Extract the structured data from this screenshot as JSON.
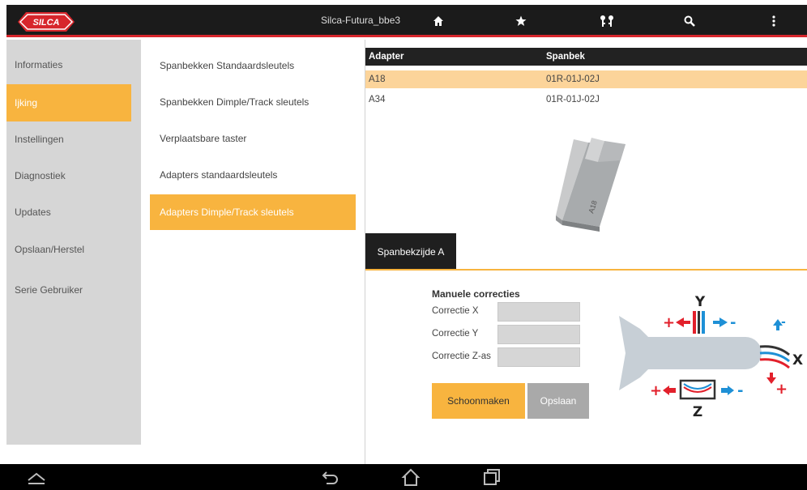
{
  "header": {
    "title": "Silca-Futura_bbe3",
    "logo_text": "SILCA",
    "icons": [
      "home-icon",
      "star-icon",
      "keys-icon",
      "search-icon",
      "more-vert-icon"
    ]
  },
  "left_menu": {
    "items": [
      {
        "label": "Informaties",
        "active": false
      },
      {
        "label": "Ijking",
        "active": true
      },
      {
        "label": "Instellingen",
        "active": false
      },
      {
        "label": "Diagnostiek",
        "active": false
      },
      {
        "label": "Updates",
        "active": false
      },
      {
        "label": "Opslaan/Herstel",
        "active": false
      },
      {
        "label": "Serie Gebruiker",
        "active": false
      }
    ]
  },
  "sub_menu": {
    "items": [
      {
        "label": "Spanbekken Standaardsleutels",
        "active": false
      },
      {
        "label": "Spanbekken Dimple/Track sleutels",
        "active": false
      },
      {
        "label": "Verplaatsbare taster",
        "active": false
      },
      {
        "label": "Adapters standaardsleutels",
        "active": false
      },
      {
        "label": "Adapters Dimple/Track sleutels",
        "active": true
      }
    ]
  },
  "adapter_table": {
    "columns": [
      "Adapter",
      "Spanbek"
    ],
    "rows": [
      {
        "adapter": "A18",
        "spanbek": "01R-01J-02J",
        "selected": true
      },
      {
        "adapter": "A34",
        "spanbek": "01R-01J-02J",
        "selected": false
      }
    ]
  },
  "adapter_image_label": "A18",
  "tab": {
    "label": "Spanbekzijde A"
  },
  "corrections": {
    "title": "Manuele correcties",
    "fields": [
      {
        "label": "Correctie X",
        "value": ""
      },
      {
        "label": "Correctie Y",
        "value": ""
      },
      {
        "label": "Correctie Z-as",
        "value": ""
      }
    ]
  },
  "buttons": {
    "clean": "Schoonmaken",
    "save": "Opslaan"
  },
  "diagram": {
    "axis_y": "Y",
    "axis_x": "X",
    "axis_z": "Z",
    "plus": "+",
    "minus": "-"
  },
  "colors": {
    "accent": "#f8b43f",
    "brand_red": "#d7262c",
    "arrow_blue": "#1e90d6"
  }
}
